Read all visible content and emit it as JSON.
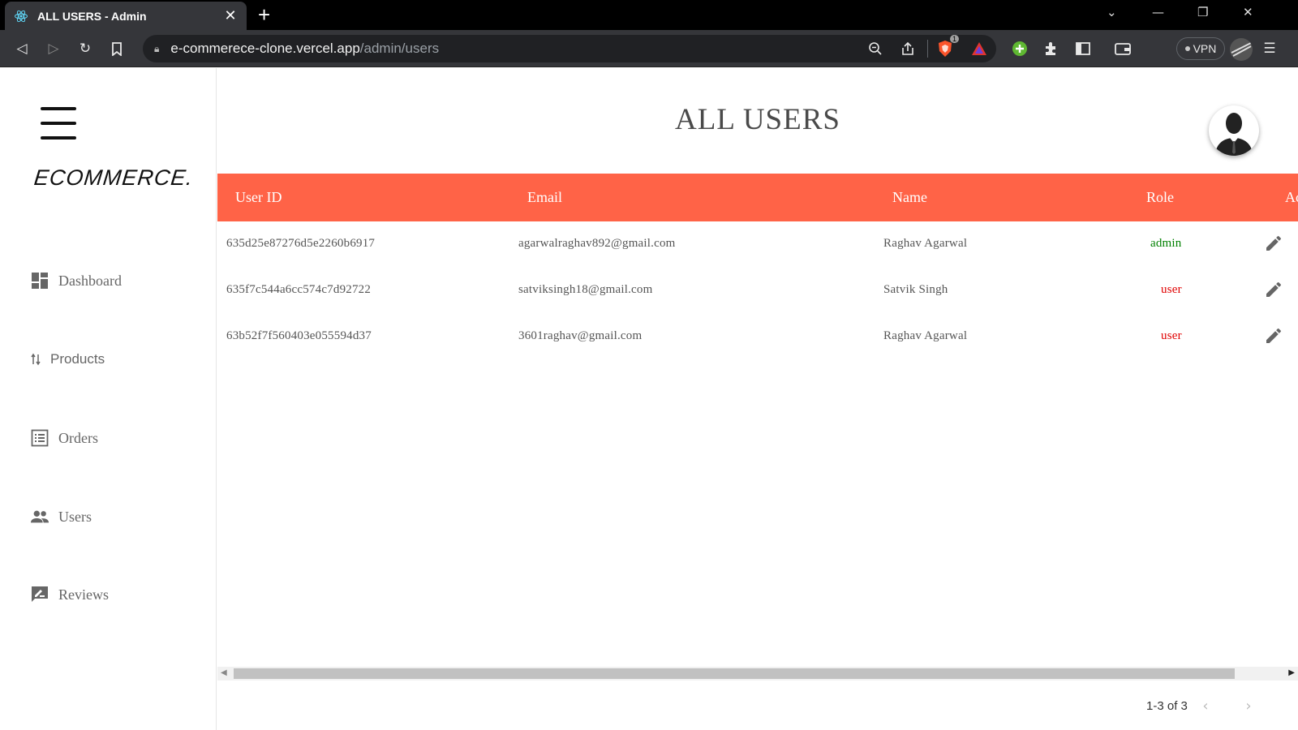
{
  "browser": {
    "tab_title": "ALL USERS - Admin",
    "tab_close": "✕",
    "new_tab": "+",
    "url_host": "e-commerece-clone.vercel.app",
    "url_path": "/admin/users",
    "vpn_label": "VPN",
    "shield_badge": "1"
  },
  "sidebar": {
    "logo": "ECOMMERCE.",
    "items": [
      {
        "label": "Dashboard",
        "icon": "dashboard-icon"
      },
      {
        "label": "Products",
        "icon": "sort-arrows-icon"
      },
      {
        "label": "Orders",
        "icon": "list-icon"
      },
      {
        "label": "Users",
        "icon": "people-icon"
      },
      {
        "label": "Reviews",
        "icon": "rate-review-icon"
      }
    ]
  },
  "page": {
    "title": "ALL USERS"
  },
  "table": {
    "columns": [
      "User ID",
      "Email",
      "Name",
      "Role",
      "Ac"
    ],
    "rows": [
      {
        "id": "635d25e87276d5e2260b6917",
        "email": "agarwalraghav892@gmail.com",
        "name": "Raghav Agarwal",
        "role": "admin"
      },
      {
        "id": "635f7c544a6cc574c7d92722",
        "email": "satviksingh18@gmail.com",
        "name": "Satvik Singh",
        "role": "user"
      },
      {
        "id": "63b52f7f560403e055594d37",
        "email": "3601raghav@gmail.com",
        "name": "Raghav Agarwal",
        "role": "user"
      }
    ],
    "pagination": "1-3 of 3"
  },
  "colors": {
    "header_bg": "#ff6347",
    "role_admin": "#008000",
    "role_user": "#e00000"
  }
}
